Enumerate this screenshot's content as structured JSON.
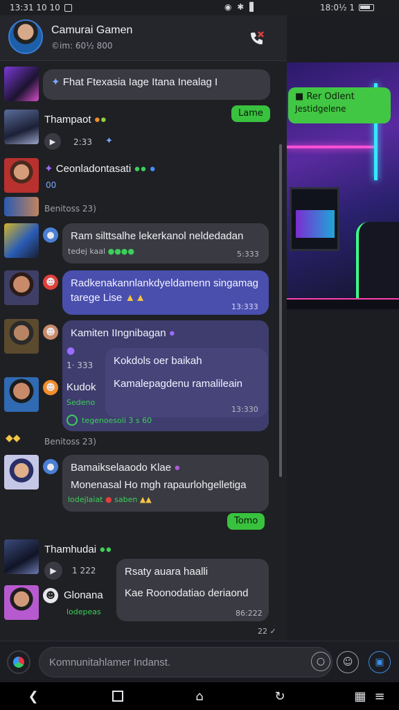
{
  "status": {
    "time": "13:31 10 10",
    "icons_mid": "◉ ✱ ▋",
    "time_right": "18:0½ 1"
  },
  "header": {
    "title": "Camurai Gamen",
    "subtitle": "©im: 60½ 800",
    "icons": [
      "phone-missed-icon",
      "emoji-icon",
      "call-icon",
      "switch-icon"
    ]
  },
  "sidepanel": {
    "bubble_line1": "Rer Odlent",
    "bubble_line2": "Jestidgelene"
  },
  "messages": {
    "top_bubble": "Fhat Ftexasia Iage Itana Inealag I",
    "tag_game": "Lame",
    "user1_name": "Thampaot",
    "user1_time": "2:33",
    "user2_name": "Ceonladontasati",
    "user2_id": "00",
    "divider1": "Benitoss 23)",
    "msg1_text": "Ram silttsalhe lekerkanol neldedadan",
    "msg1_meta": "tedej kaal",
    "msg1_time": "5:333",
    "msg2_line1": "Radkenakannlankdyeldamenn singamag",
    "msg2_line2": "tarege Lise",
    "msg2_time": "13:333",
    "msg3_name": "Kamiten IIngnibagan",
    "msg3_time_small": "1· 333",
    "msg3_overlay1": "Kokdols oer baikah",
    "msg3_name2": "Kudok",
    "msg3_overlay2": "Kamalepagdenu ramalileain",
    "msg3_meta": "Sedeno",
    "msg3_time": "13:330",
    "msg3_status": "tegenoesoli 3 s 60",
    "divider2": "Benitoss 23)",
    "msg4_line1": "Bamaikselaaodo Klae",
    "msg4_line2": "Monenasal Ho mgh rapaurlohgelletiga",
    "msg4_meta": "lodejlaiat",
    "msg4_meta2": "saben",
    "tag_game2": "Tomo",
    "user3_name": "Thamhudai",
    "user3_time": "1 222",
    "user4_name": "Glonana",
    "user4_meta": "lodepeas",
    "msg5_line1": "Rsaty auara haalli",
    "msg5_line2": "Kae Roonodatiao deriaond",
    "msg5_time": "86:222",
    "footer_tick": "22"
  },
  "input": {
    "placeholder": "Komnunitahlamer Indanst."
  },
  "colors": {
    "accent_green": "#39c23e",
    "bubble_blue": "#4a4fae",
    "bubble_dark": "#3a3b42"
  }
}
